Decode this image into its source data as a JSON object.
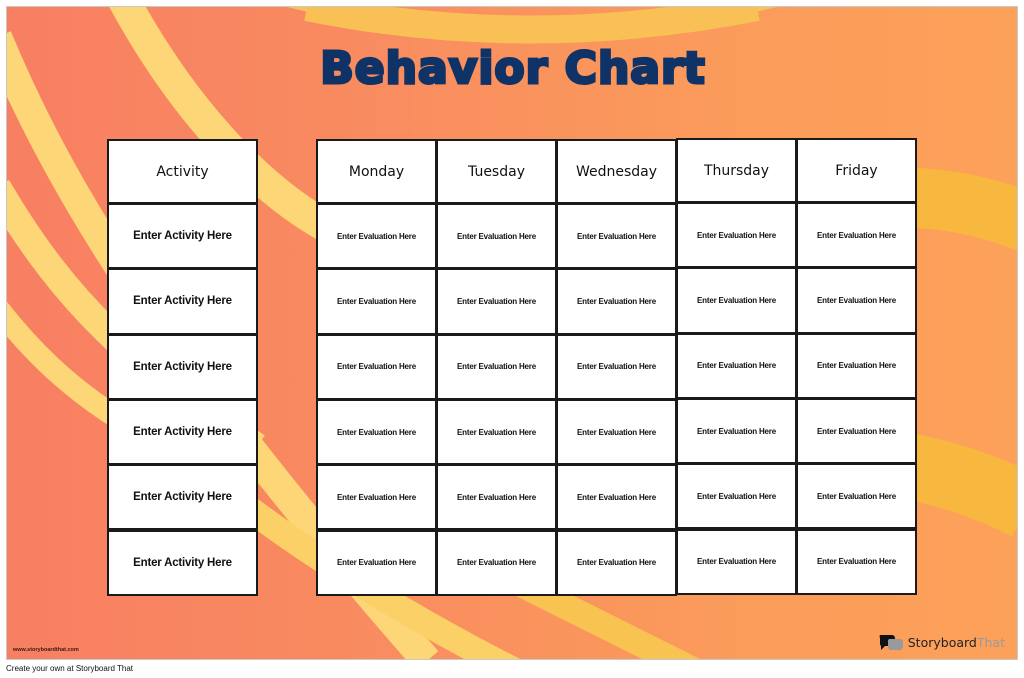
{
  "poster": {
    "title": "Behavior Chart",
    "colors": {
      "background_left": "#f77f62",
      "background_right": "#fca15a",
      "stripe_light": "#fcd677",
      "stripe_gold": "#f8b840",
      "title": "#0f3366"
    }
  },
  "table": {
    "activity_header": "Activity",
    "days": [
      "Monday",
      "Tuesday",
      "Wednesday",
      "Thursday",
      "Friday"
    ],
    "activities": [
      "Enter Activity Here",
      "Enter Activity Here",
      "Enter Activity Here",
      "Enter Activity Here",
      "Enter Activity Here",
      "Enter Activity Here"
    ],
    "evaluation_placeholder": "Enter Evaluation Here",
    "rows": [
      [
        "Enter Evaluation Here",
        "Enter Evaluation Here",
        "Enter Evaluation Here",
        "Enter Evaluation Here",
        "Enter Evaluation Here"
      ],
      [
        "Enter Evaluation Here",
        "Enter Evaluation Here",
        "Enter Evaluation Here",
        "Enter Evaluation Here",
        "Enter Evaluation Here"
      ],
      [
        "Enter Evaluation Here",
        "Enter Evaluation Here",
        "Enter Evaluation Here",
        "Enter Evaluation Here",
        "Enter Evaluation Here"
      ],
      [
        "Enter Evaluation Here",
        "Enter Evaluation Here",
        "Enter Evaluation Here",
        "Enter Evaluation Here",
        "Enter Evaluation Here"
      ],
      [
        "Enter Evaluation Here",
        "Enter Evaluation Here",
        "Enter Evaluation Here",
        "Enter Evaluation Here",
        "Enter Evaluation Here"
      ],
      [
        "Enter Evaluation Here",
        "Enter Evaluation Here",
        "Enter Evaluation Here",
        "Enter Evaluation Here",
        "Enter Evaluation Here"
      ]
    ]
  },
  "branding": {
    "website": "www.storyboardthat.com",
    "logo_word_dark": "Storyboard",
    "logo_word_light": "That",
    "logo_icon": "speech-bubbles-icon"
  },
  "footer": {
    "text": "Create your own at Storyboard That"
  }
}
